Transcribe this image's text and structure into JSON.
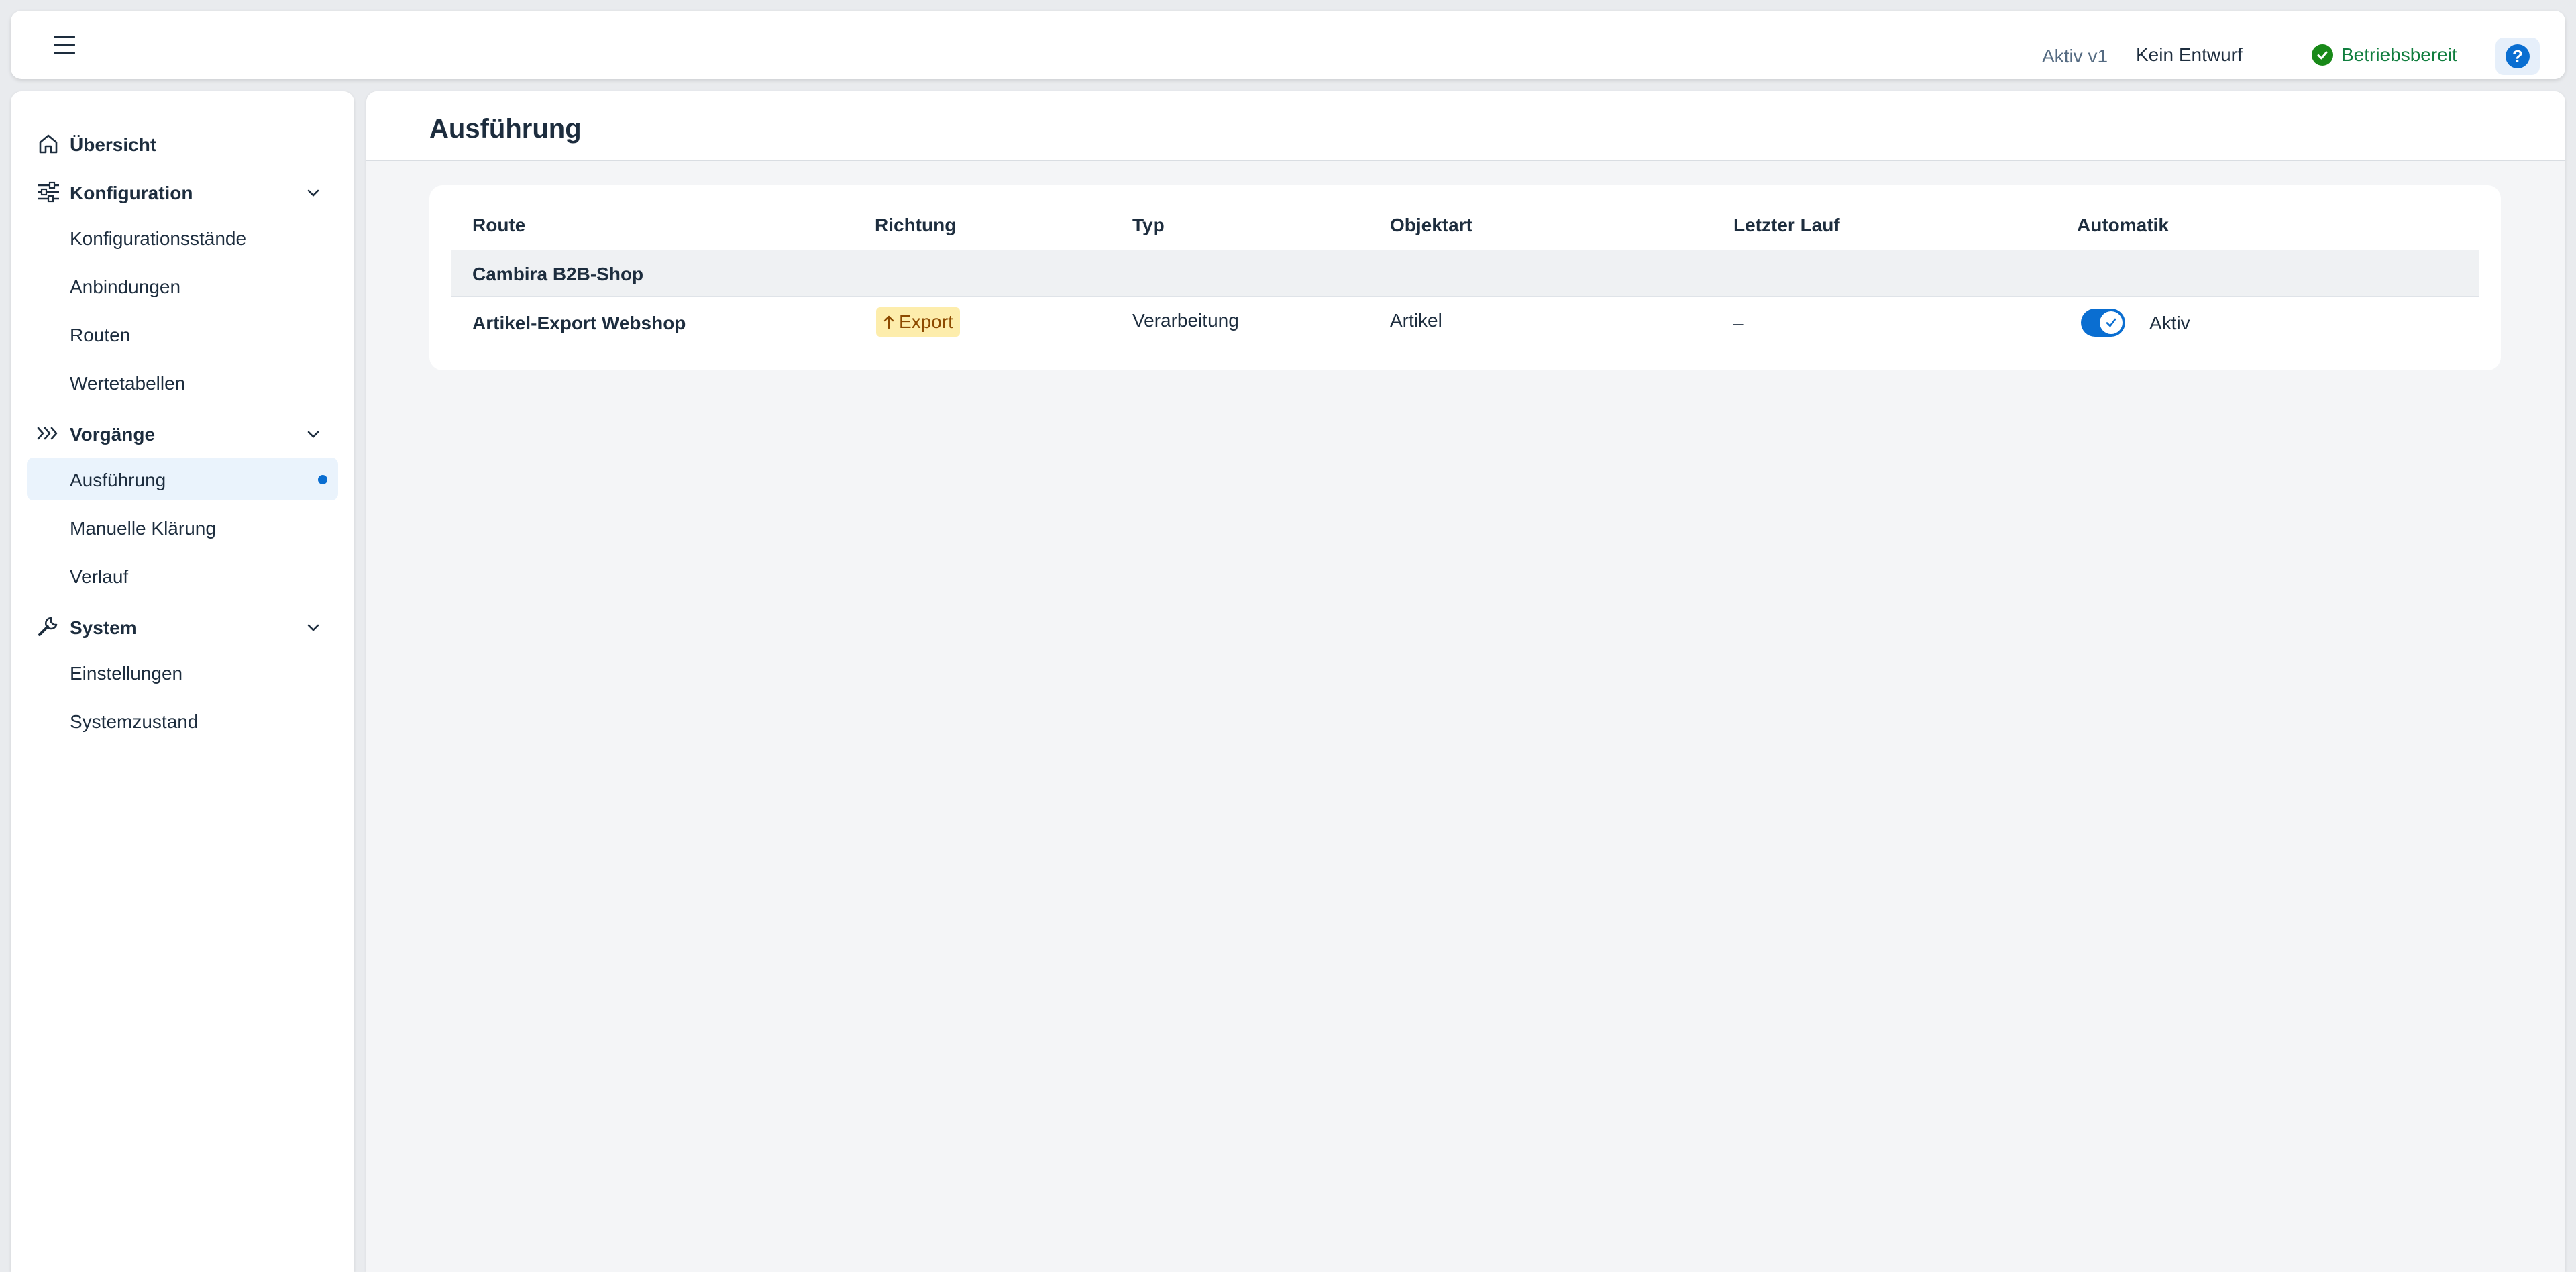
{
  "shellbar": {
    "version": "Aktiv v1",
    "draft": "Kein Entwurf",
    "status": "Betriebsbereit",
    "colors": {
      "status": "#107e3e",
      "accent": "#0a6ed1"
    }
  },
  "sidebar": {
    "overview": "Übersicht",
    "groups": [
      {
        "label": "Konfiguration",
        "icon": "sliders-icon",
        "items": [
          "Konfigurationsstände",
          "Anbindungen",
          "Routen",
          "Wertetabellen"
        ]
      },
      {
        "label": "Vorgänge",
        "icon": "process-icon",
        "items": [
          "Ausführung",
          "Manuelle Klärung",
          "Verlauf"
        ]
      },
      {
        "label": "System",
        "icon": "wrench-icon",
        "items": [
          "Einstellungen",
          "Systemzustand"
        ]
      }
    ],
    "active_item": "Ausführung"
  },
  "page": {
    "title": "Ausführung"
  },
  "table": {
    "columns": [
      "Route",
      "Richtung",
      "Typ",
      "Objektart",
      "Letzter Lauf",
      "Automatik"
    ],
    "group": "Cambira B2B-Shop",
    "rows": [
      {
        "route": "Artikel-Export Webshop",
        "direction": "Export",
        "type": "Verarbeitung",
        "object": "Artikel",
        "last_run": "–",
        "automatic": "Aktiv",
        "automatic_enabled": true
      }
    ]
  }
}
